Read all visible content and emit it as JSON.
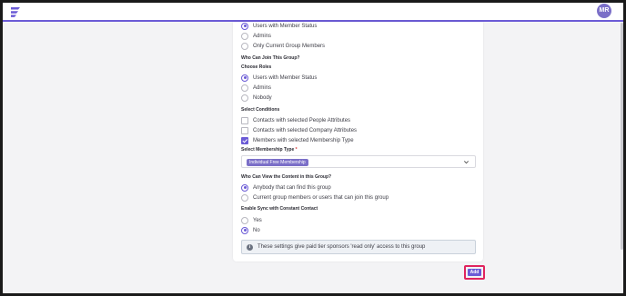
{
  "header": {
    "avatar_initials": "MR",
    "logo_icon": "app-logo-icon",
    "accent_color": "#6b5bd6"
  },
  "form": {
    "top_options": [
      {
        "label": "Users with Member Status",
        "selected": true
      },
      {
        "label": "Admins",
        "selected": false
      },
      {
        "label": "Only Current Group Members",
        "selected": false
      }
    ],
    "join_title": "Who Can Join This Group?",
    "choose_roles_title": "Choose Roles",
    "roles": [
      {
        "label": "Users with Member Status",
        "selected": true
      },
      {
        "label": "Admins",
        "selected": false
      },
      {
        "label": "Nobody",
        "selected": false
      }
    ],
    "conditions_title": "Select Conditions",
    "conditions": [
      {
        "label": "Contacts with selected People Attributes",
        "checked": false
      },
      {
        "label": "Contacts with selected Company Attributes",
        "checked": false
      },
      {
        "label": "Members with selected Membership Type",
        "checked": true
      }
    ],
    "membership_type_title": "Select Membership Type",
    "membership_type_required": "*",
    "membership_type_value": "Individual Free Membership",
    "view_title": "Who Can View the Content in this Group?",
    "view_options": [
      {
        "label": "Anybody that can find this group",
        "selected": true
      },
      {
        "label": "Current group members or users that can join this group",
        "selected": false
      }
    ],
    "sync_title": "Enable Sync with Constant Contact",
    "sync_options": [
      {
        "label": "Yes",
        "selected": false
      },
      {
        "label": "No",
        "selected": true
      }
    ],
    "info_text": "These settings give paid tier sponsors 'read only' access to this group",
    "add_label": "Add"
  }
}
